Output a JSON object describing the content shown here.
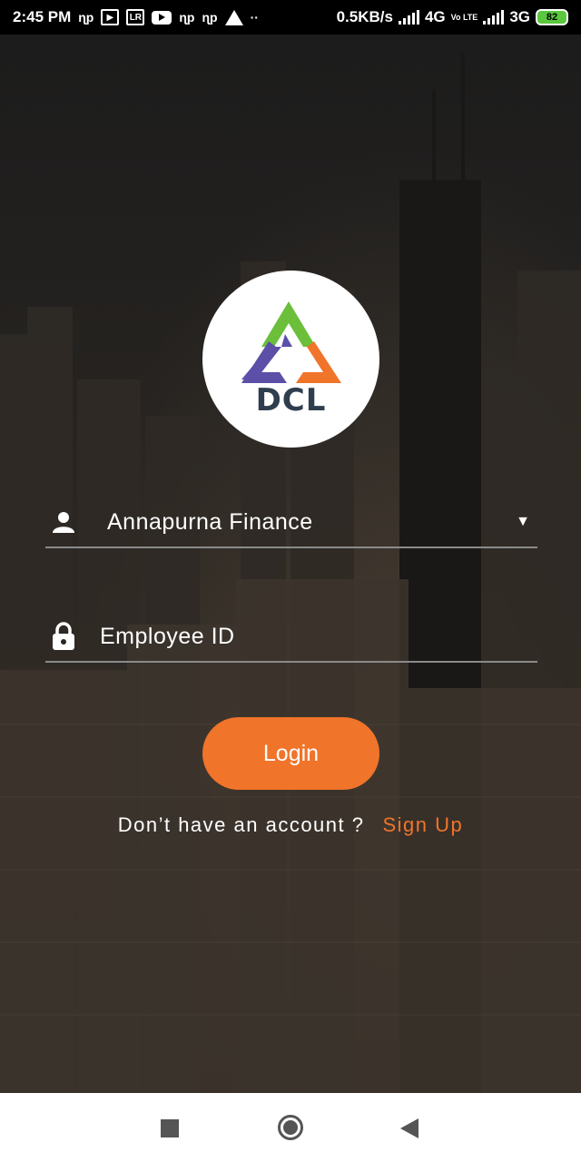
{
  "status_bar": {
    "time": "2:45 PM",
    "np1": "ɳp",
    "lr": "LR",
    "np2": "ɳp",
    "np3": "ɳp",
    "dots": "··",
    "speed": "0.5KB/s",
    "net1": "4G",
    "volte": "Vo LTE",
    "net2": "3G",
    "battery": "82"
  },
  "logo": {
    "text": "DCL",
    "colors": {
      "green": "#6bbf3b",
      "purple": "#5b4fa8",
      "orange": "#f0742a"
    }
  },
  "form": {
    "company": {
      "value": "Annapurna Finance",
      "icon": "person-icon"
    },
    "employee": {
      "placeholder": "Employee ID",
      "icon": "lock-icon"
    },
    "login_label": "Login",
    "signup_prompt": "Don’t have an account ?",
    "signup_link": "Sign Up"
  },
  "colors": {
    "accent": "#f0742a"
  }
}
